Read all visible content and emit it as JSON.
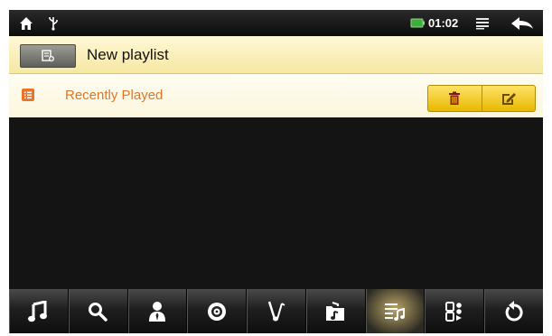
{
  "status_bar": {
    "time": "01:02",
    "icons": [
      "home-icon",
      "usb-icon",
      "battery-icon",
      "menu-icon",
      "back-icon"
    ]
  },
  "playlist_bar": {
    "new_button_icon": "new-playlist-icon",
    "new_label": "New playlist"
  },
  "list": {
    "items": [
      {
        "icon": "playlist-icon",
        "label": "Recently Played"
      }
    ],
    "actions": [
      "delete-icon",
      "edit-icon"
    ]
  },
  "toolbar": {
    "items": [
      {
        "icon": "music-note-icon"
      },
      {
        "icon": "search-icon"
      },
      {
        "icon": "artist-icon"
      },
      {
        "icon": "album-icon"
      },
      {
        "icon": "genre-icon"
      },
      {
        "icon": "folder-music-icon"
      },
      {
        "icon": "playlist-icon",
        "active": true
      },
      {
        "icon": "apps-icon"
      },
      {
        "icon": "refresh-icon"
      }
    ]
  },
  "colors": {
    "accent_orange": "#e0762a",
    "header_yellow": "#f6e7a2",
    "action_gold": "#e8b800",
    "battery_green": "#3fae3a"
  }
}
